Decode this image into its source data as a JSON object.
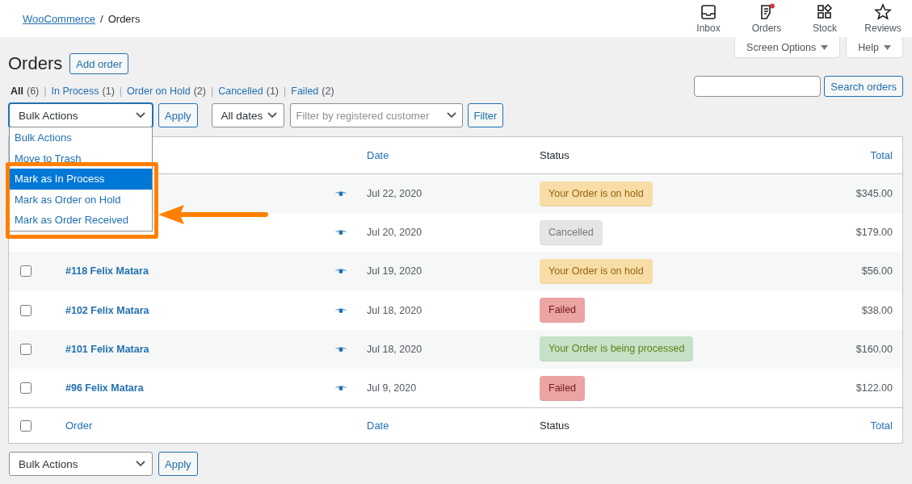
{
  "breadcrumb": {
    "link": "WooCommerce",
    "separator": "/",
    "current": "Orders"
  },
  "toolbar": [
    {
      "label": "Inbox",
      "kind": "inbox",
      "badge": false
    },
    {
      "label": "Orders",
      "kind": "orders",
      "badge": true
    },
    {
      "label": "Stock",
      "kind": "stock",
      "badge": false
    },
    {
      "label": "Reviews",
      "kind": "reviews",
      "badge": false
    }
  ],
  "view_separator": "|",
  "screen_tabs": [
    "Screen Options",
    "Help"
  ],
  "title": "Orders",
  "add_button": "Add order",
  "views": [
    {
      "label": "All",
      "count": "(6)",
      "selected": true
    },
    {
      "label": "In Process",
      "count": "(1)",
      "selected": false
    },
    {
      "label": "Order on Hold",
      "count": "(2)",
      "selected": false
    },
    {
      "label": "Cancelled",
      "count": "(1)",
      "selected": false
    },
    {
      "label": "Failed",
      "count": "(2)",
      "selected": false
    }
  ],
  "search": {
    "button": "Search orders"
  },
  "filters": {
    "bulk": "Bulk Actions",
    "apply": "Apply",
    "dates": "All dates",
    "customer_placeholder": "Filter by registered customer",
    "filter": "Filter"
  },
  "bulk_menu": [
    {
      "label": "Bulk Actions",
      "selected": false
    },
    {
      "label": "Move to Trash",
      "selected": false
    },
    {
      "label": "Mark as In Process",
      "selected": true
    },
    {
      "label": "Mark as Order on Hold",
      "selected": false
    },
    {
      "label": "Mark as Order Received",
      "selected": false
    }
  ],
  "header": {
    "date": "Date",
    "status": "Status",
    "total": "Total"
  },
  "rows": [
    {
      "date": "Jul 22, 2020",
      "status": "Your Order is on hold",
      "kind": "on-hold",
      "total": "$345.00"
    },
    {
      "date": "Jul 20, 2020",
      "status": "Cancelled",
      "kind": "cancelled",
      "total": "$179.00"
    },
    {
      "order": "#118 Felix Matara",
      "checked": false,
      "date": "Jul 19, 2020",
      "status": "Your Order is on hold",
      "kind": "on-hold",
      "total": "$56.00"
    },
    {
      "order": "#102 Felix Matara",
      "checked": false,
      "date": "Jul 18, 2020",
      "status": "Failed",
      "kind": "failed",
      "total": "$38.00"
    },
    {
      "order": "#101 Felix Matara",
      "checked": false,
      "date": "Jul 18, 2020",
      "status": "Your Order is being processed",
      "kind": "processing",
      "total": "$160.00"
    },
    {
      "order": "#96 Felix Matara",
      "checked": false,
      "date": "Jul 9, 2020",
      "status": "Failed",
      "kind": "failed",
      "total": "$122.00"
    }
  ],
  "footer": {
    "checked": false,
    "order": "Order",
    "date": "Date",
    "status": "Status",
    "total": "Total"
  },
  "bottom": {
    "bulk": "Bulk Actions",
    "apply": "Apply"
  }
}
